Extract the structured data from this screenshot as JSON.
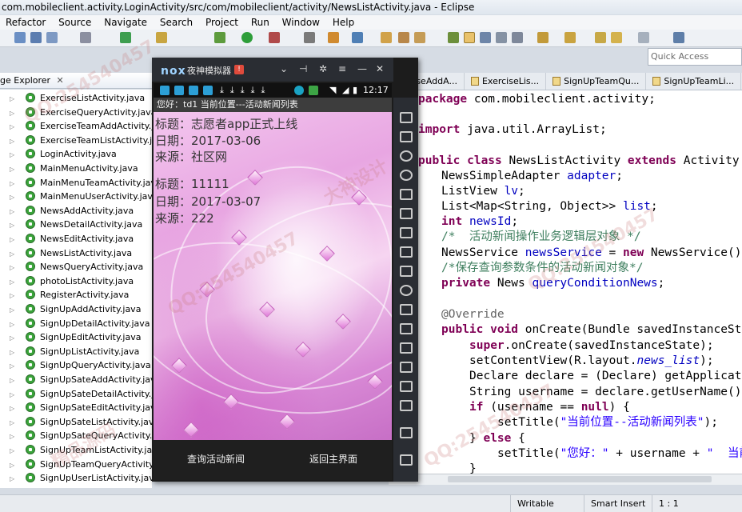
{
  "window": {
    "title": "com.mobileclient.activity.LoginActivity/src/com/mobileclient/activity/NewsListActivity.java - Eclipse"
  },
  "menu": [
    "Refactor",
    "Source",
    "Navigate",
    "Search",
    "Project",
    "Run",
    "Window",
    "Help"
  ],
  "quick_access": {
    "placeholder": "Quick Access"
  },
  "package_explorer": {
    "tab_label": "ge Explorer",
    "files": [
      "ExerciseListActivity.java",
      "ExerciseQueryActivity.java",
      "ExerciseTeamAddActivity.java",
      "ExerciseTeamListActivity.java",
      "LoginActivity.java",
      "MainMenuActivity.java",
      "MainMenuTeamActivity.java",
      "MainMenuUserActivity.java",
      "NewsAddActivity.java",
      "NewsDetailActivity.java",
      "NewsEditActivity.java",
      "NewsListActivity.java",
      "NewsQueryActivity.java",
      "photoListActivity.java",
      "RegisterActivity.java",
      "SignUpAddActivity.java",
      "SignUpDetailActivity.java",
      "SignUpEditActivity.java",
      "SignUpListActivity.java",
      "SignUpQueryActivity.java",
      "SignUpSateAddActivity.java",
      "SignUpSateDetailActivity.java",
      "SignUpSateEditActivity.java",
      "SignUpSateListActivity.java",
      "SignUpSateQueryActivity.java",
      "SignUpTeamListActivity.java",
      "SignUpTeamQueryActivity.java",
      "SignUpUserListActivity.java"
    ]
  },
  "editor": {
    "tabs": [
      "xerciseAddA...",
      "ExerciseLis...",
      "SignUpTeamQu...",
      "SignUpTeamLi..."
    ]
  },
  "status": {
    "writable": "Writable",
    "insert": "Smart Insert",
    "position": "1 : 1"
  },
  "emulator": {
    "logo": "nox",
    "name": "夜神模拟器",
    "badge": "!",
    "clock": "12:17",
    "app_title": "您好：td1  当前位置---活动新闻列表",
    "news": [
      {
        "title": "标题：志愿者app正式上线",
        "date": "日期：2017-03-06",
        "source": "来源：社区网"
      },
      {
        "title": "标题：11111",
        "date": "日期：2017-03-07",
        "source": "来源：222"
      }
    ],
    "buttons": {
      "query": "查询活动新闻",
      "back": "返回主界面"
    }
  },
  "colors": {
    "keyword": "#7f0055",
    "field": "#0000c0",
    "comment": "#3f7f5f",
    "string": "#2a00ff"
  }
}
